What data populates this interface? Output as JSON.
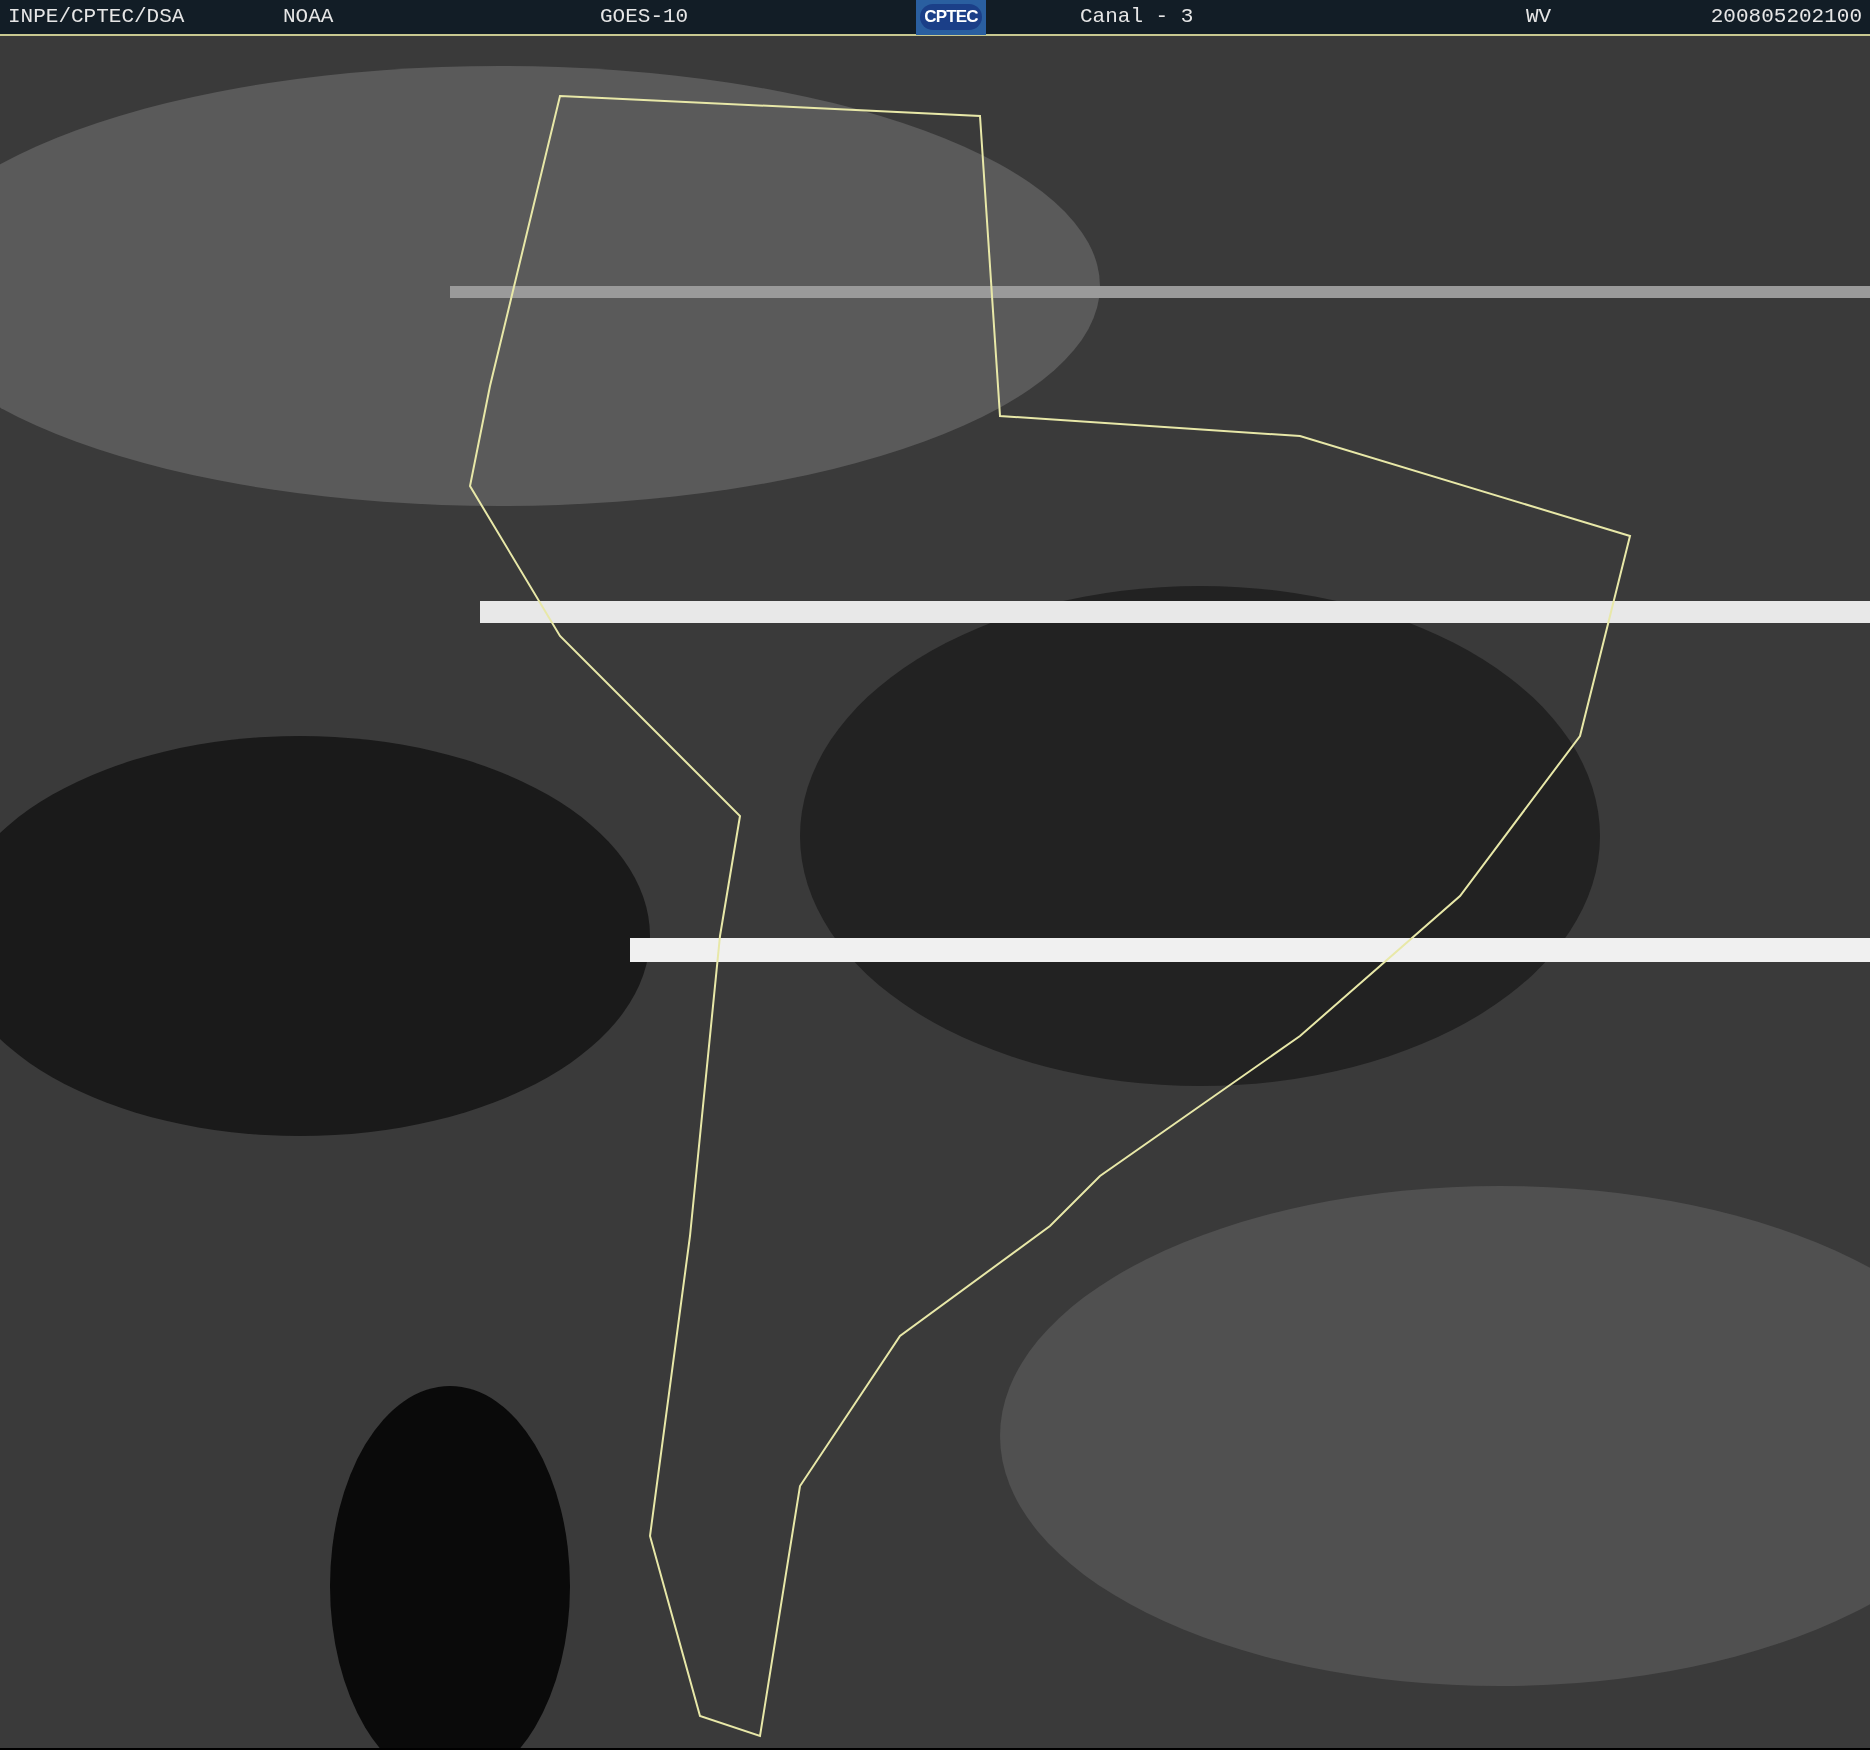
{
  "header": {
    "source": "INPE/CPTEC/DSA",
    "agency": "NOAA",
    "satellite": "GOES-10",
    "logo": "CPTEC",
    "channel": "Canal - 3",
    "band": "WV",
    "timestamp": "200805202100"
  }
}
